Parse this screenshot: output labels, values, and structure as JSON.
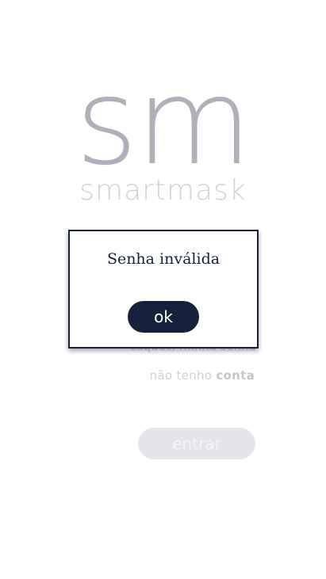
{
  "logo": {
    "mark": "sm",
    "name": "smartmask"
  },
  "login": {
    "forgot_password": "esqueci minha senha",
    "no_account_prefix": "não tenho",
    "no_account_link": "conta",
    "submit_label": "entrar"
  },
  "dialog": {
    "message": "Senha inválida",
    "ok_label": "ok"
  },
  "colors": {
    "primary": "#16213b",
    "logo_gray": "#aeb1b9",
    "muted_button": "#e4e5e8"
  }
}
